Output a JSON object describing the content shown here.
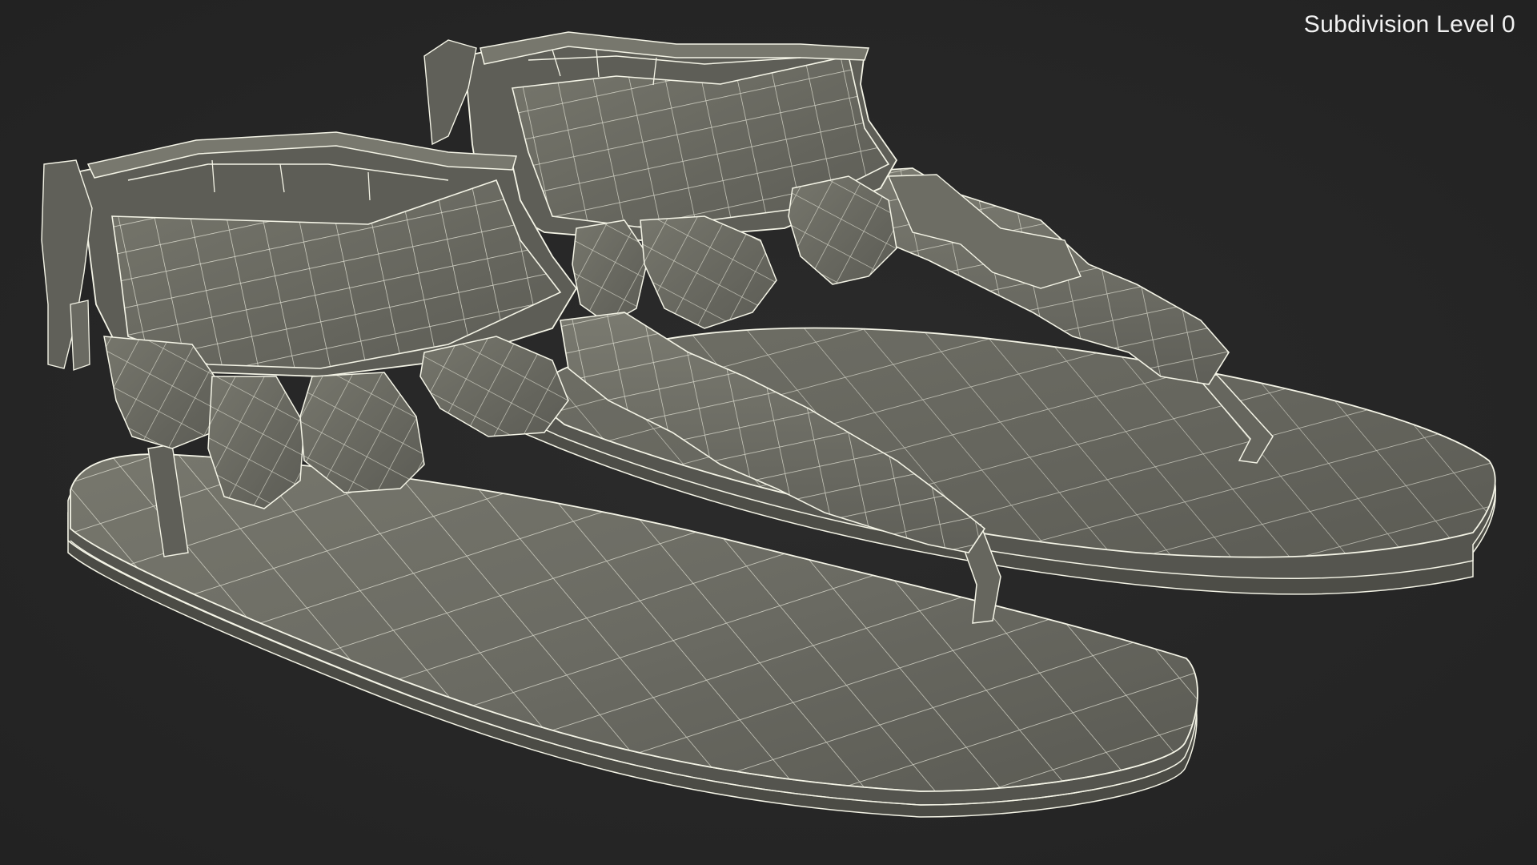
{
  "viewport": {
    "label": "Subdivision Level 0"
  },
  "scene": {
    "subject": "sandals-pair-wireframe-model",
    "background_color": "#262626",
    "mesh_fill_color": "#6f6f66",
    "mesh_shadow_color": "#4b4b45",
    "wire_color": "#f4f4e6"
  }
}
